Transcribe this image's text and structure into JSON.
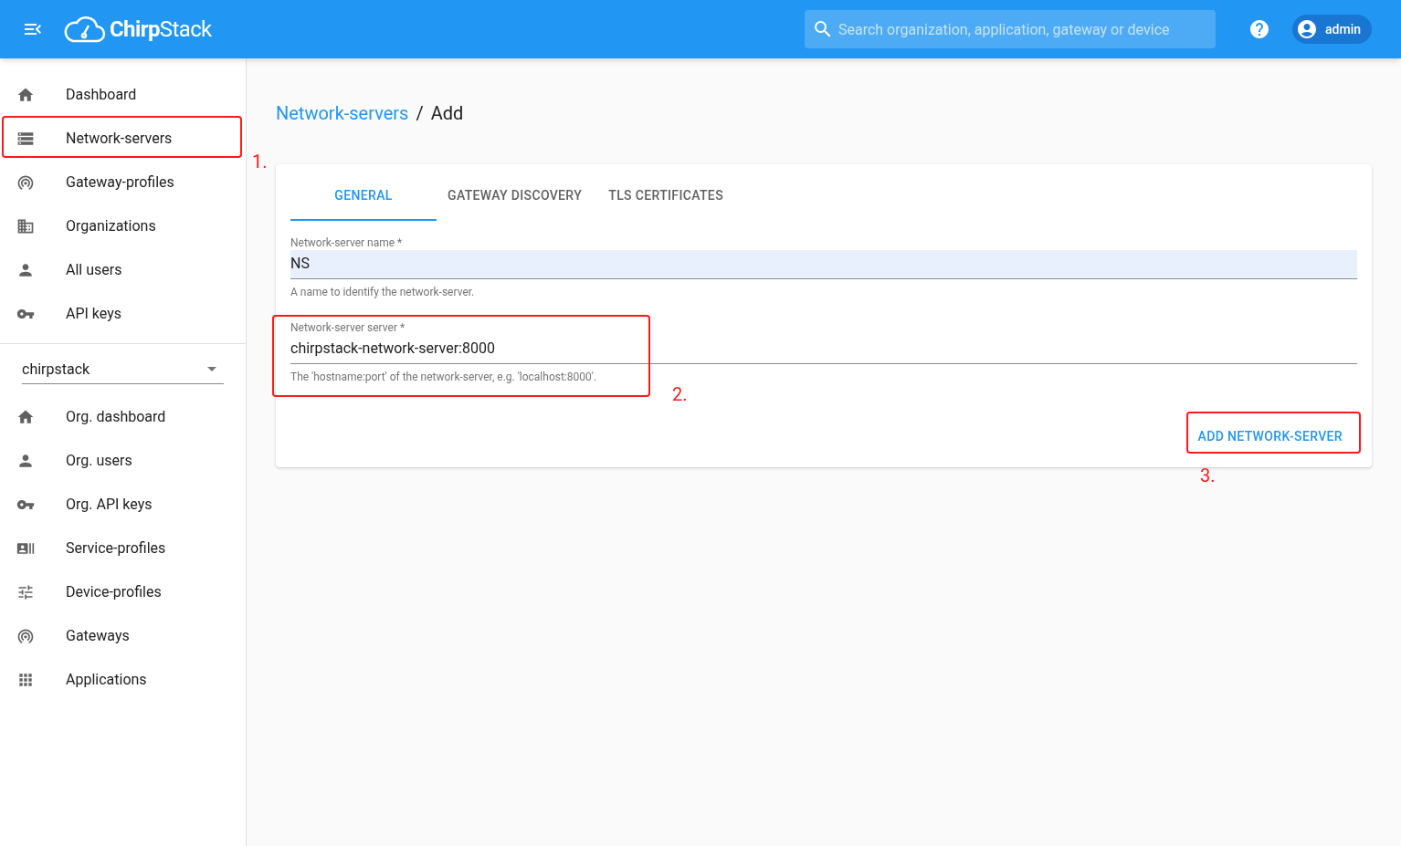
{
  "header": {
    "logo": "**Chirp**Stack",
    "search": {
      "placeholder": "Search organization, application, gateway or device"
    },
    "user": "admin"
  },
  "sidebar": {
    "items": [
      {
        "label": "Dashboard"
      },
      {
        "label": "Network-servers"
      },
      {
        "label": "Gateway-profiles"
      },
      {
        "label": "Organizations"
      },
      {
        "label": "All users"
      },
      {
        "label": "API keys"
      }
    ],
    "organization_select": {
      "value": "chirpstack"
    },
    "org_items": [
      {
        "label": "Org. dashboard"
      },
      {
        "label": "Org. users"
      },
      {
        "label": "Org. API keys"
      },
      {
        "label": "Service-profiles"
      },
      {
        "label": "Device-profiles"
      },
      {
        "label": "Gateways"
      },
      {
        "label": "Applications"
      }
    ]
  },
  "breadcrumb": {
    "link": "Network-servers",
    "separator": "/",
    "current": "Add"
  },
  "tabs": [
    {
      "label": "GENERAL",
      "selected": true
    },
    {
      "label": "GATEWAY DISCOVERY",
      "selected": false
    },
    {
      "label": "TLS CERTIFICATES",
      "selected": false
    }
  ],
  "fields": [
    {
      "label": "Network-server name *",
      "value": "NS",
      "helper": "A name to identify the network-server.",
      "autofilled": true
    },
    {
      "label": "Network-server server *",
      "value": "chirpstack-network-server:8000",
      "helper": "The 'hostname:port' of the network-server, e.g. 'localhost:8000'.",
      "autofilled": false
    }
  ],
  "submit_button": "ADD NETWORK-SERVER",
  "annotations": [
    {
      "label": "1."
    },
    {
      "label": "2."
    },
    {
      "label": "3."
    }
  ]
}
